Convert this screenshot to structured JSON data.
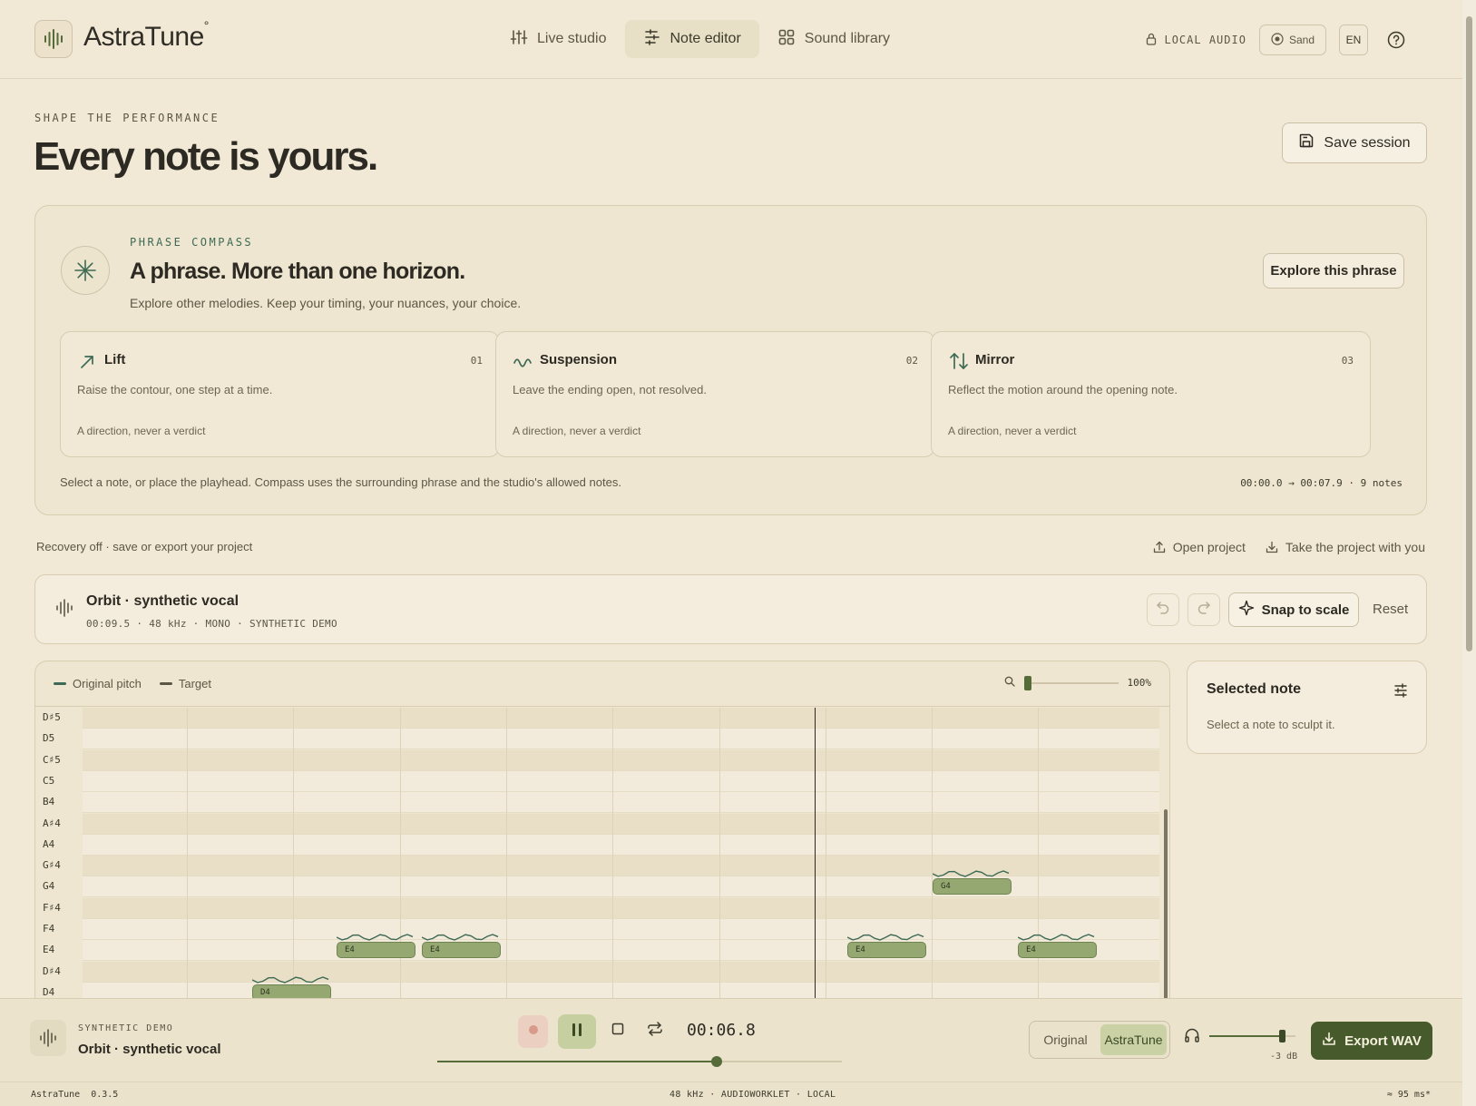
{
  "app": {
    "logo": "AstraTune",
    "logo_mark": "°"
  },
  "nav": {
    "items": [
      {
        "label": "Live studio",
        "icon": "sliders-icon"
      },
      {
        "label": "Note editor",
        "icon": "note-edit-icon",
        "active": true
      },
      {
        "label": "Sound library",
        "icon": "grid-icon"
      }
    ]
  },
  "header": {
    "local_audio": "LOCAL AUDIO",
    "theme": "Sand",
    "lang": "EN"
  },
  "page": {
    "eyebrow": "SHAPE THE PERFORMANCE",
    "title": "Every note is yours.",
    "save_label": "Save session"
  },
  "compass": {
    "eyebrow": "PHRASE COMPASS",
    "title": "A phrase. More than one horizon.",
    "subtitle": "Explore other melodies. Keep your timing, your nuances, your choice.",
    "explore_label": "Explore this phrase",
    "cards": [
      {
        "name": "Lift",
        "num": "01",
        "desc": "Raise the contour, one step at a time.",
        "foot": "A direction, never a verdict",
        "icon": "arrow-up-right-icon"
      },
      {
        "name": "Suspension",
        "num": "02",
        "desc": "Leave the ending open, not resolved.",
        "foot": "A direction, never a verdict",
        "icon": "wave-icon"
      },
      {
        "name": "Mirror",
        "num": "03",
        "desc": "Reflect the motion around the opening note.",
        "foot": "A direction, never a verdict",
        "icon": "arrows-up-down-icon"
      }
    ],
    "hint": "Select a note, or place the playhead. Compass uses the surrounding phrase and the studio's allowed notes.",
    "range": "00:00.0 → 00:07.9 · 9 notes"
  },
  "project": {
    "recovery": "Recovery off · save or export your project",
    "open_label": "Open project",
    "take_label": "Take the project with you"
  },
  "track": {
    "name": "Orbit · synthetic vocal",
    "meta": "00:09.5 · 48 kHz · MONO · SYNTHETIC DEMO",
    "snap_label": "Snap to scale",
    "reset_label": "Reset"
  },
  "roll": {
    "legend_original": "Original pitch",
    "legend_target": "Target",
    "zoom": "100%",
    "pitches": [
      "D♯5",
      "D5",
      "C♯5",
      "C5",
      "B4",
      "A♯4",
      "A4",
      "G♯4",
      "G4",
      "F♯4",
      "F4",
      "E4",
      "D♯4",
      "D4"
    ],
    "notes": [
      {
        "label": "D4",
        "pitch": "D4"
      },
      {
        "label": "E4",
        "pitch": "E4"
      },
      {
        "label": "E4",
        "pitch": "E4"
      },
      {
        "label": "E4",
        "pitch": "E4"
      },
      {
        "label": "G4",
        "pitch": "G4"
      },
      {
        "label": "E4",
        "pitch": "E4"
      }
    ]
  },
  "selected": {
    "title": "Selected note",
    "subtitle": "Select a note to sculpt it."
  },
  "transport": {
    "eyebrow": "SYNTHETIC DEMO",
    "name": "Orbit · synthetic vocal",
    "time": "00:06.8",
    "progress": 0.69,
    "ab_original": "Original",
    "ab_astratune": "AstraTune",
    "volume_db": "-3 dB",
    "volume": 0.84,
    "export_label": "Export WAV"
  },
  "status": {
    "version": "AstraTune  0.3.5",
    "engine": "48 kHz · AUDIOWORKLET · LOCAL",
    "latency": "≈ 95 ms*"
  },
  "colors": {
    "background": "#f1e9d6",
    "accent": "#465a2b",
    "note": "#96a871",
    "compass_eyebrow": "#3d6a54"
  }
}
